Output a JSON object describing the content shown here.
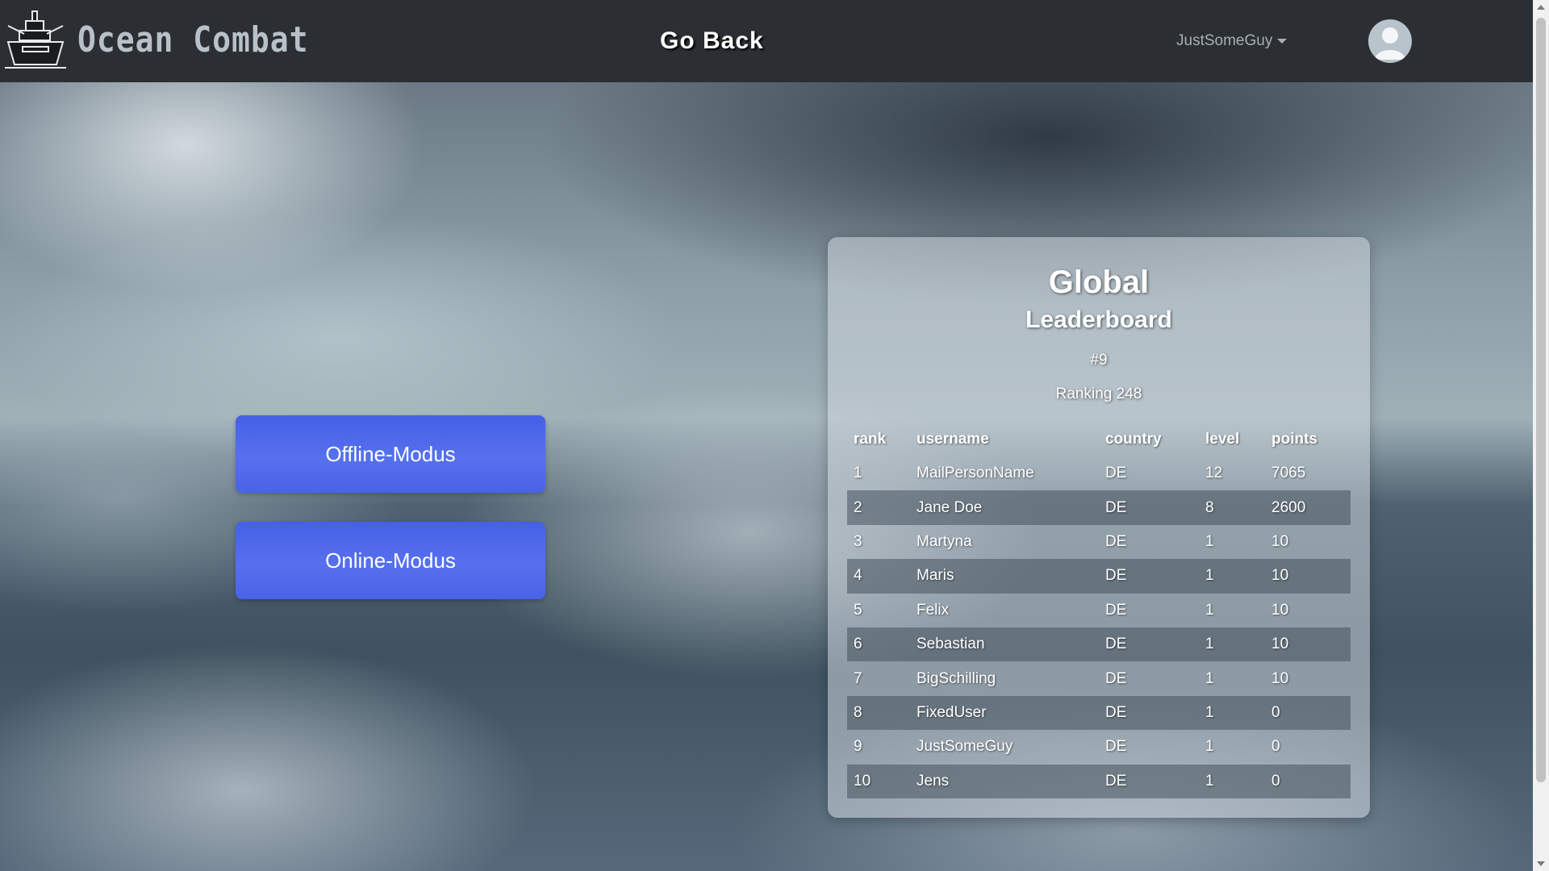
{
  "app": {
    "brand": "Ocean Combat",
    "nav_link": "Go Back",
    "username": "JustSomeGuy"
  },
  "actions": {
    "offline": "Offline-Modus",
    "online": "Online-Modus"
  },
  "leaderboard": {
    "title": "Global",
    "subtitle": "Leaderboard",
    "own_rank": "#9",
    "ranking": "Ranking 248",
    "columns": [
      "rank",
      "username",
      "country",
      "level",
      "points"
    ],
    "rows": [
      {
        "rank": "1",
        "username": "MailPersonName",
        "country": "DE",
        "level": "12",
        "points": "7065"
      },
      {
        "rank": "2",
        "username": "Jane Doe",
        "country": "DE",
        "level": "8",
        "points": "2600"
      },
      {
        "rank": "3",
        "username": "Martyna",
        "country": "DE",
        "level": "1",
        "points": "10"
      },
      {
        "rank": "4",
        "username": "Maris",
        "country": "DE",
        "level": "1",
        "points": "10"
      },
      {
        "rank": "5",
        "username": "Felix",
        "country": "DE",
        "level": "1",
        "points": "10"
      },
      {
        "rank": "6",
        "username": "Sebastian",
        "country": "DE",
        "level": "1",
        "points": "10"
      },
      {
        "rank": "7",
        "username": "BigSchilling",
        "country": "DE",
        "level": "1",
        "points": "10"
      },
      {
        "rank": "8",
        "username": "FixedUser",
        "country": "DE",
        "level": "1",
        "points": "0"
      },
      {
        "rank": "9",
        "username": "JustSomeGuy",
        "country": "DE",
        "level": "1",
        "points": "0"
      },
      {
        "rank": "10",
        "username": "Jens",
        "country": "DE",
        "level": "1",
        "points": "0"
      }
    ]
  },
  "icons": {
    "logo": "battleship-icon",
    "avatar": "user-avatar-icon",
    "dropdown": "caret-down-icon"
  },
  "colors": {
    "navbar": "#2b2f33",
    "button": "#4f68ea"
  }
}
